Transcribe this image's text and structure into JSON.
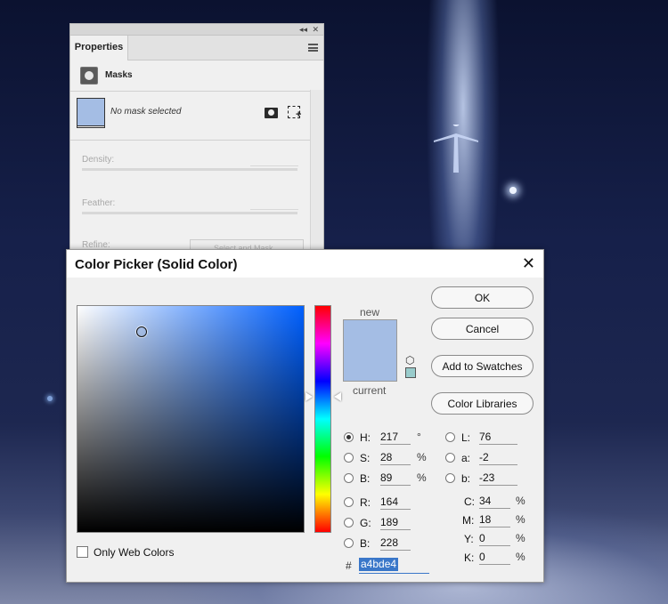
{
  "properties_panel": {
    "tab": "Properties",
    "section": "Masks",
    "mask_status": "No mask selected",
    "density_label": "Density:",
    "feather_label": "Feather:",
    "refine_label": "Refine:",
    "select_mask_button": "Select and Mask..."
  },
  "color_picker": {
    "title": "Color Picker (Solid Color)",
    "close_symbol": "✕",
    "new_label": "new",
    "current_label": "current",
    "buttons": {
      "ok": "OK",
      "cancel": "Cancel",
      "add_to_swatches": "Add to Swatches",
      "color_libraries": "Color Libraries"
    },
    "hsb": {
      "h": {
        "label": "H:",
        "value": "217",
        "unit": "°"
      },
      "s": {
        "label": "S:",
        "value": "28",
        "unit": "%"
      },
      "b": {
        "label": "B:",
        "value": "89",
        "unit": "%"
      }
    },
    "rgb": {
      "r": {
        "label": "R:",
        "value": "164"
      },
      "g": {
        "label": "G:",
        "value": "189"
      },
      "b": {
        "label": "B:",
        "value": "228"
      }
    },
    "lab": {
      "l": {
        "label": "L:",
        "value": "76"
      },
      "a": {
        "label": "a:",
        "value": "-2"
      },
      "b": {
        "label": "b:",
        "value": "-23"
      }
    },
    "cmyk": {
      "c": {
        "label": "C:",
        "value": "34",
        "unit": "%"
      },
      "m": {
        "label": "M:",
        "value": "18",
        "unit": "%"
      },
      "y": {
        "label": "Y:",
        "value": "0",
        "unit": "%"
      },
      "k": {
        "label": "K:",
        "value": "0",
        "unit": "%"
      }
    },
    "hex_sign": "#",
    "hex": "a4bde4",
    "only_web_colors": "Only Web Colors",
    "selected_channel": "H",
    "colors": {
      "new": "#a4bde4",
      "current": "#a4bde4",
      "websafe": "#99cccc"
    }
  }
}
